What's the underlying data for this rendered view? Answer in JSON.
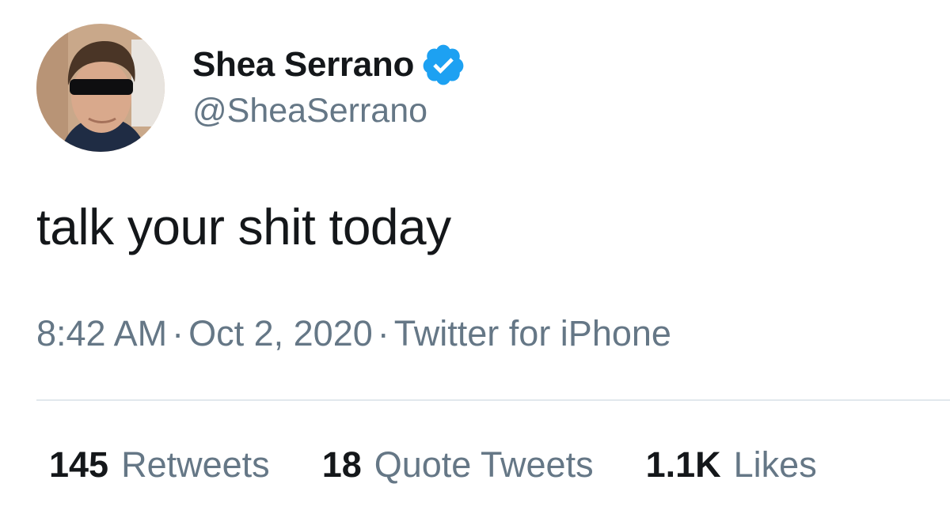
{
  "author": {
    "display_name": "Shea Serrano",
    "handle": "@SheaSerrano",
    "verified": true,
    "verified_color": "#1da1f2"
  },
  "tweet": {
    "text": "talk your shit today",
    "time": "8:42 AM",
    "date": "Oct 2, 2020",
    "separator": "·",
    "source": "Twitter for iPhone"
  },
  "stats": {
    "retweets_count": "145",
    "retweets_label": "Retweets",
    "quotes_count": "18",
    "quotes_label": "Quote Tweets",
    "likes_count": "1.1K",
    "likes_label": "Likes"
  }
}
